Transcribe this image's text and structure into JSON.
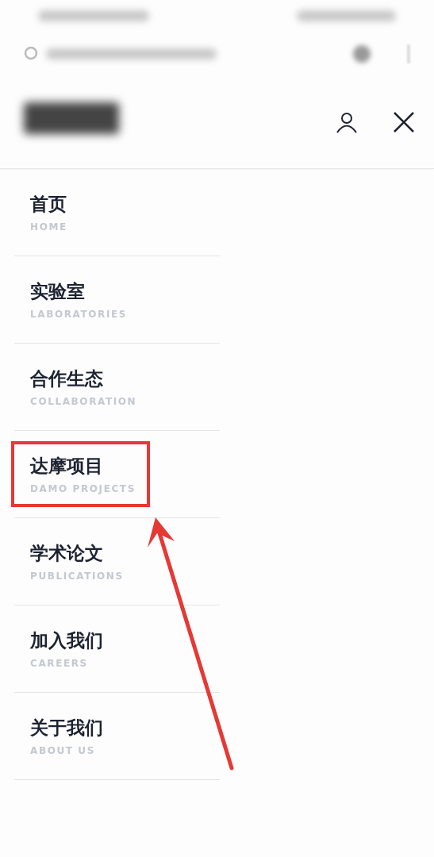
{
  "menu": {
    "items": [
      {
        "label": "首页",
        "subtitle": "HOME",
        "highlighted": false
      },
      {
        "label": "实验室",
        "subtitle": "LABORATORIES",
        "highlighted": false
      },
      {
        "label": "合作生态",
        "subtitle": "COLLABORATION",
        "highlighted": false
      },
      {
        "label": "达摩项目",
        "subtitle": "DAMO PROJECTS",
        "highlighted": true
      },
      {
        "label": "学术论文",
        "subtitle": "PUBLICATIONS",
        "highlighted": false
      },
      {
        "label": "加入我们",
        "subtitle": "CAREERS",
        "highlighted": false
      },
      {
        "label": "关于我们",
        "subtitle": "ABOUT US",
        "highlighted": false
      }
    ]
  }
}
